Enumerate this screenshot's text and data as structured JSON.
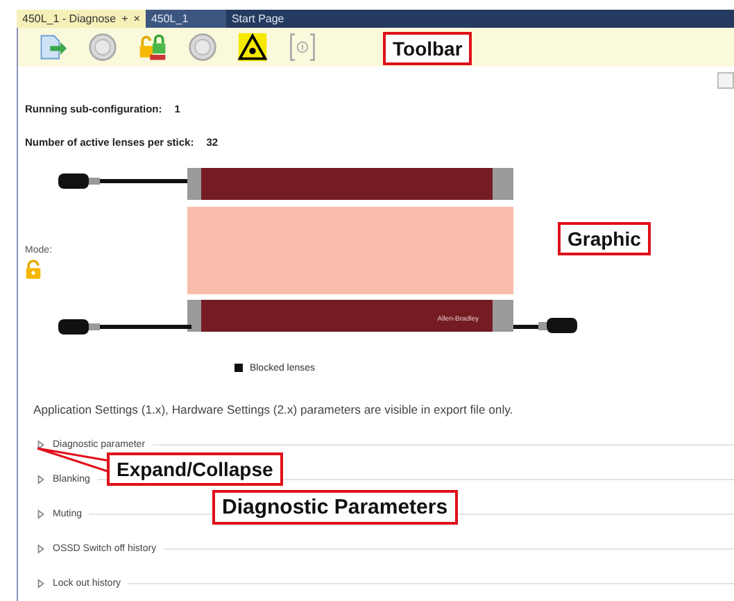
{
  "tabs": [
    {
      "label": "450L_1 - Diagnose",
      "selected": true,
      "pin": "+",
      "close": "×"
    },
    {
      "label": "450L_1",
      "selected": false
    },
    {
      "label": "Start Page",
      "selected": false
    }
  ],
  "toolbar": {
    "buttons": [
      {
        "kind": "export"
      },
      {
        "kind": "disc"
      },
      {
        "kind": "lock"
      },
      {
        "kind": "disc"
      },
      {
        "kind": "laser"
      },
      {
        "kind": "info"
      }
    ]
  },
  "status": [
    {
      "label": "Running sub-configuration:",
      "value": "1"
    },
    {
      "label": "Number of active lenses per stick:",
      "value": "32"
    }
  ],
  "graphic": {
    "mode_label": "Mode:",
    "locked": false,
    "brand": "Allen-Bradley",
    "legend": "Blocked lenses"
  },
  "note": "Application Settings (1.x), Hardware Settings (2.x) parameters are visible in export file only.",
  "sections": [
    {
      "label": "Diagnostic parameter",
      "expanded": false
    },
    {
      "label": "Blanking",
      "expanded": false
    },
    {
      "label": "Muting",
      "expanded": false
    },
    {
      "label": "OSSD Switch off history",
      "expanded": false
    },
    {
      "label": "Lock out history",
      "expanded": false
    }
  ],
  "callouts": [
    {
      "kind": "toolbar",
      "text": "Toolbar"
    },
    {
      "kind": "graphic",
      "text": "Graphic"
    },
    {
      "kind": "expand",
      "text": "Expand/Collapse"
    },
    {
      "kind": "params",
      "text": "Diagnostic Parameters"
    }
  ]
}
